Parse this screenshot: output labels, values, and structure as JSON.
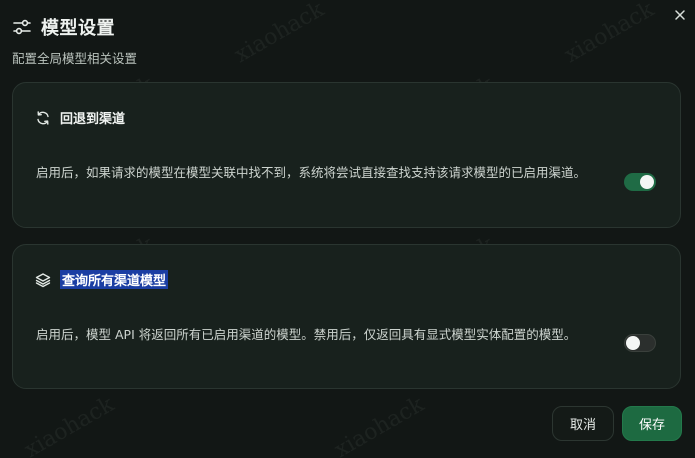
{
  "dialog": {
    "title": "模型设置",
    "subtitle": "配置全局模型相关设置",
    "header_icon": "sliders-icon",
    "close_icon": "close-icon"
  },
  "settings": [
    {
      "icon": "refresh-icon",
      "title": "回退到渠道",
      "description": "启用后，如果请求的模型在模型关联中找不到，系统将尝试直接查找支持该请求模型的已启用渠道。",
      "enabled": true
    },
    {
      "icon": "layers-icon",
      "title": "查询所有渠道模型",
      "description": "启用后，模型 API 将返回所有已启用渠道的模型。禁用后，仅返回具有显式模型实体配置的模型。",
      "enabled": false
    }
  ],
  "footer": {
    "cancel_label": "取消",
    "save_label": "保存"
  },
  "watermark": {
    "text": "xiaohack"
  },
  "colors": {
    "accent": "#1f6b45",
    "background": "#121715",
    "card": "#18211d",
    "selection": "#1b3ea3"
  }
}
